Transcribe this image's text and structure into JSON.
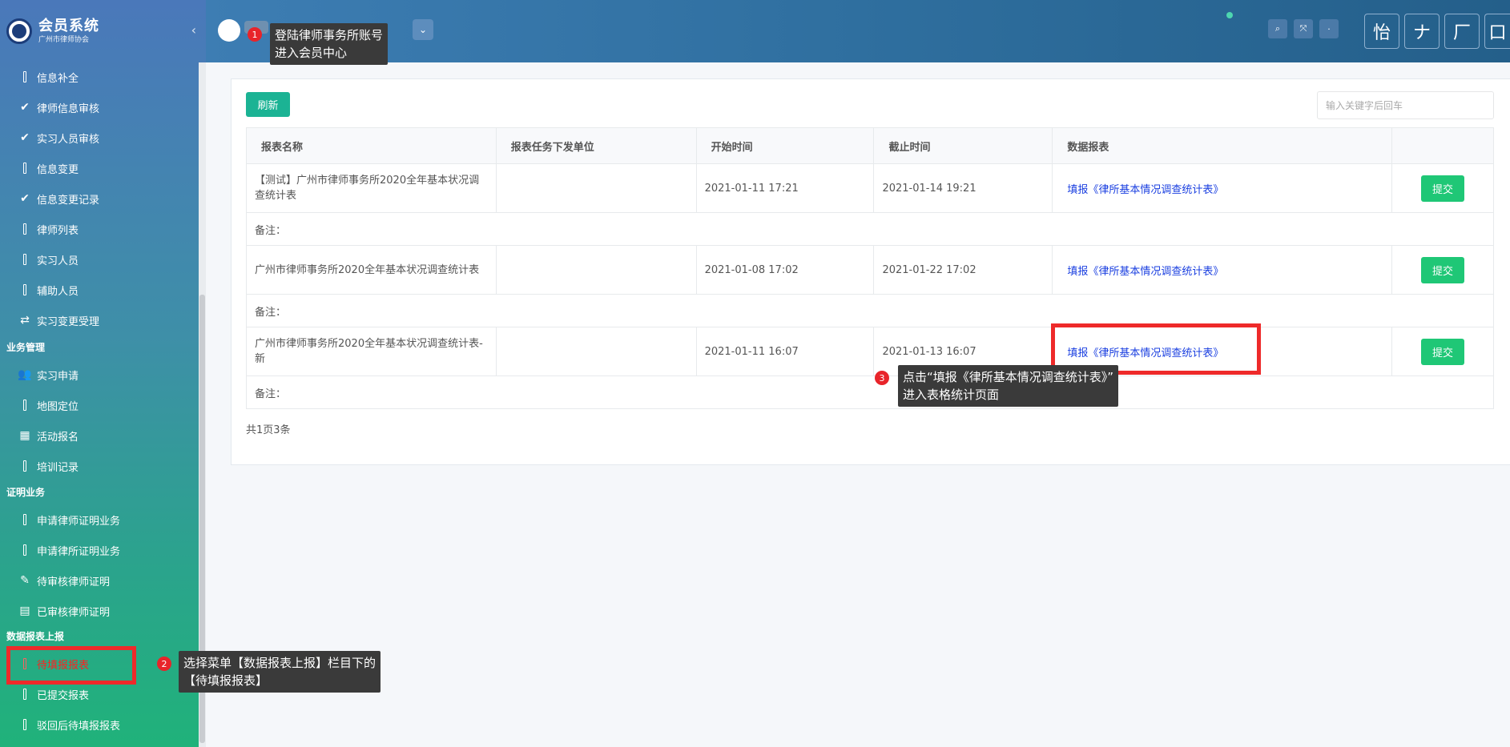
{
  "brand": {
    "title": "会员系统",
    "subtitle": "广州市律师协会"
  },
  "sidebar": {
    "items": [
      {
        "label": "信息补全",
        "icon": "bar-icon"
      },
      {
        "label": "律师信息审核",
        "icon": "check-icon"
      },
      {
        "label": "实习人员审核",
        "icon": "check-icon"
      },
      {
        "label": "信息变更",
        "icon": "bar-icon"
      },
      {
        "label": "信息变更记录",
        "icon": "check-icon"
      },
      {
        "label": "律师列表",
        "icon": "bar-icon"
      },
      {
        "label": "实习人员",
        "icon": "bar-icon"
      },
      {
        "label": "辅助人员",
        "icon": "bar-icon"
      },
      {
        "label": "实习变更受理",
        "icon": "exchange-icon"
      }
    ],
    "sections": [
      {
        "title": "业务管理",
        "items": [
          {
            "label": "实习申请",
            "icon": "users-icon"
          },
          {
            "label": "地图定位",
            "icon": "bar-icon"
          },
          {
            "label": "活动报名",
            "icon": "calendar-icon"
          },
          {
            "label": "培训记录",
            "icon": "bar-icon"
          }
        ]
      },
      {
        "title": "证明业务",
        "items": [
          {
            "label": "申请律师证明业务",
            "icon": "bar-icon"
          },
          {
            "label": "申请律所证明业务",
            "icon": "bar-icon"
          },
          {
            "label": "待审核律师证明",
            "icon": "edit-icon"
          },
          {
            "label": "已审核律师证明",
            "icon": "file-icon"
          }
        ]
      },
      {
        "title": "数据报表上报",
        "items": [
          {
            "label": "待填报报表",
            "icon": "bar-icon"
          },
          {
            "label": "已提交报表",
            "icon": "bar-icon"
          },
          {
            "label": "驳回后待填报报表",
            "icon": "bar-icon"
          }
        ]
      }
    ]
  },
  "header": {
    "icons": [
      "search-icon",
      "fullscreen-icon",
      "settings-icon"
    ],
    "boxes": [
      "怡",
      "ナ",
      "厂",
      "口"
    ]
  },
  "toolbar": {
    "refresh_label": "刷新",
    "search_placeholder": "输入关键字后回车"
  },
  "table": {
    "columns": [
      "报表名称",
      "报表任务下发单位",
      "开始时间",
      "截止时间",
      "数据报表",
      ""
    ],
    "note_label": "备注：",
    "rows": [
      {
        "name": "【测试】广州市律师事务所2020全年基本状况调查统计表",
        "unit": "",
        "start": "2021-01-11 17:21",
        "end": "2021-01-14 19:21",
        "link": "填报《律所基本情况调查统计表》",
        "action": "提交"
      },
      {
        "name": "广州市律师事务所2020全年基本状况调查统计表",
        "unit": "",
        "start": "2021-01-08 17:02",
        "end": "2021-01-22 17:02",
        "link": "填报《律所基本情况调查统计表》",
        "action": "提交"
      },
      {
        "name": "广州市律师事务所2020全年基本状况调查统计表-新",
        "unit": "",
        "start": "2021-01-11 16:07",
        "end": "2021-01-13 16:07",
        "link": "填报《律所基本情况调查统计表》",
        "action": "提交"
      }
    ]
  },
  "pager": {
    "text": "共1页3条"
  },
  "annotations": [
    {
      "step": "1",
      "text_line1": "登陆律师事务所账号",
      "text_line2": "进入会员中心"
    },
    {
      "step": "2",
      "text_line1": "选择菜单【数据报表上报】栏目下的",
      "text_line2": "【待填报报表】"
    },
    {
      "step": "3",
      "text_line1": "点击“填报《律所基本情况调查统计表》”",
      "text_line2": "进入表格统计页面"
    }
  ],
  "colors": {
    "accent": "#1bb394",
    "submit": "#1fc776",
    "link": "#1a3fe0",
    "highlight": "#ee2a2a"
  }
}
